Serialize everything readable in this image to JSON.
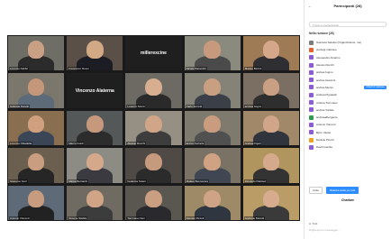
{
  "participants_panel": {
    "title": "Partecipanti (28)",
    "search_placeholder": "Trova un partecipante",
    "section": "Nella riunione (28)",
    "participants": [
      {
        "name": "Gianluca Salvato (Organizzatore, me)",
        "color": "#7d7d7d"
      },
      {
        "name": "pierluigi maltrone",
        "color": "#e8612c"
      },
      {
        "name": "Alessandro Alvarino",
        "color": "#8d5bd6"
      },
      {
        "name": "Alessio Rocchi",
        "color": "#8d5bd6"
      },
      {
        "name": "andrea bugno",
        "color": "#8d5bd6"
      },
      {
        "name": "andrea Giannini",
        "color": "#8d5bd6"
      },
      {
        "name": "andrea Mezzo",
        "color": "#8d5bd6"
      },
      {
        "name": "Andrea Pignatelli",
        "color": "#8d5bd6"
      },
      {
        "name": "Andrea Tommaso",
        "color": "#8d5bd6"
      },
      {
        "name": "andrea Visibile",
        "color": "#8d5bd6"
      },
      {
        "name": "andreaalberganto",
        "color": "#2e9c4e"
      },
      {
        "name": "Antonio Visconti",
        "color": "#8d5bd6"
      },
      {
        "name": "Bjorn Vastel",
        "color": "#8d5bd6"
      },
      {
        "name": "Daniele Piccoli",
        "color": "#f0a020"
      },
      {
        "name": "David Gentile",
        "color": "#8d5bd6"
      }
    ],
    "row_action": "Chiedi di riattivare",
    "buttons": {
      "invite": "Invita",
      "mute_all": "Disattiva audio per tutti"
    },
    "chat_title": "Chattare",
    "chat_to": "A: Tutti",
    "chat_placeholder": "Digita qui un messaggio..."
  },
  "video_grid": {
    "tiles": [
      {
        "label": "Lorenzo Fabbri",
        "skin": "#c9a083",
        "shirt": "#2b2b2b",
        "bg": "#6e6e66"
      },
      {
        "label": "Francesco Rossi",
        "skin": "#d2a985",
        "shirt": "#1c1c24",
        "bg": "#5a5048"
      },
      {
        "name_only": "millerexcine"
      },
      {
        "label": "Nicola Piacentini",
        "skin": "#c79a7e",
        "shirt": "#4a4a4a",
        "bg": "#8a8a7e"
      },
      {
        "label": "Matteo Bertini",
        "skin": "#d4a68a",
        "shirt": "#2f2f33",
        "bg": "#9e7b55"
      },
      {
        "label": "Gabriele Naretti",
        "skin": "#c4977a",
        "shirt": "#5d6a78",
        "bg": "#7c776c"
      },
      {
        "name_only": "Vincenzo Alaterna"
      },
      {
        "label": "Lorenzo Monti",
        "skin": "#d8ae90",
        "shirt": "#2a2a2a",
        "bg": "#6d6a63"
      },
      {
        "label": "Carlo Ferretti",
        "skin": "#c99f82",
        "shirt": "#3b3f48",
        "bg": "#858277"
      },
      {
        "label": "andrea bugno",
        "skin": "#caa085",
        "shirt": "#2e2e2e",
        "bg": "#7a6f62"
      },
      {
        "label": "Lorenzo Cittadella",
        "skin": "#cf9f7f",
        "shirt": "#3a4656",
        "bg": "#8a6e50"
      },
      {
        "label": "Marco Guidi",
        "skin": "#c6997c",
        "shirt": "#2c2c2c",
        "bg": "#545858"
      },
      {
        "label": "Alessio Rocchi",
        "skin": "#d1a587",
        "shirt": "#3d3d3d",
        "bg": "#969084"
      },
      {
        "label": "Enrico Ferraris",
        "skin": "#c99c7f",
        "shirt": "#505050",
        "bg": "#7f7a6e"
      },
      {
        "label": "Andrea Figuli",
        "skin": "#d0a589",
        "shirt": "#30343c",
        "bg": "#a08868"
      },
      {
        "label": "Giacomo Ferri",
        "skin": "#c89d80",
        "shirt": "#262626",
        "bg": "#6b5f4f"
      },
      {
        "label": "Mattia Bernardi",
        "skin": "#d3a88b",
        "shirt": "#3a3a40",
        "bg": "#8c8c84"
      },
      {
        "label": "Federica Solari",
        "skin": "#c59a7d",
        "shirt": "#2b2b2b",
        "bg": "#4f4a45"
      },
      {
        "label": "Matteo Buonocore",
        "skin": "#cfa284",
        "shirt": "#404652",
        "bg": "#7a7264"
      },
      {
        "label": "Riccardo Palmieri",
        "skin": "#d5aa8c",
        "shirt": "#333",
        "bg": "#b0955f"
      },
      {
        "label": "Antonio Visconti",
        "skin": "#c79b7e",
        "shirt": "#222",
        "bg": "#5e6a78"
      },
      {
        "label": "Simone Stabile",
        "skin": "#d0a486",
        "shirt": "#3c3c3c",
        "bg": "#6f6a62"
      },
      {
        "label": "Tommaso Neri",
        "skin": "#c99e81",
        "shirt": "#2a2a2e",
        "bg": "#5a5650"
      },
      {
        "label": "Daniele Piccoli",
        "skin": "#cfa386",
        "shirt": "#2f3640",
        "bg": "#9e8a66"
      },
      {
        "label": "Gabriele Moretti",
        "skin": "#d6ab8e",
        "shirt": "#3a3a3a",
        "bg": "#b99c66"
      }
    ]
  }
}
